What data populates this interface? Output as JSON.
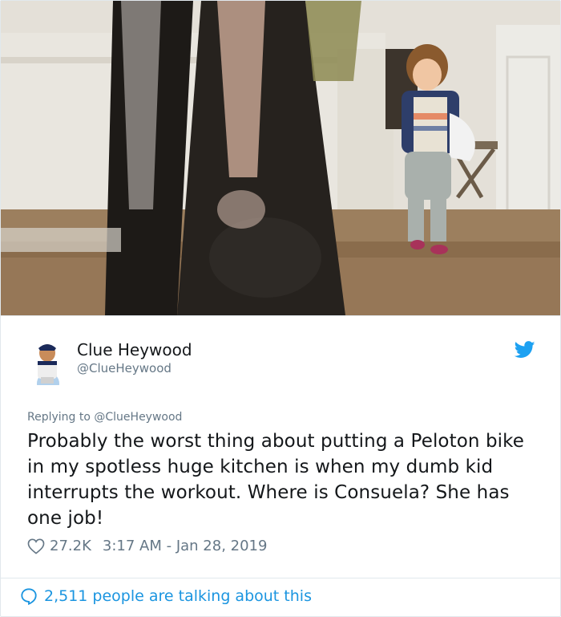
{
  "media": {
    "icon": "video-still"
  },
  "tweet": {
    "author_name": "Clue Heywood",
    "author_handle": "@ClueHeywood",
    "replying_label": "Replying to",
    "replying_handle": "@ClueHeywood",
    "text": "Probably the worst thing about putting a Peloton bike in my spotless huge kitchen is when my dumb kid interrupts the workout. Where is Consuela? She has one job!",
    "likes": "27.2K",
    "timestamp": "3:17 AM - Jan 28, 2019",
    "talking": "2,511 people are talking about this"
  },
  "colors": {
    "twitter_blue": "#1da1f2",
    "link_blue": "#1b95e0",
    "muted": "#657786"
  }
}
